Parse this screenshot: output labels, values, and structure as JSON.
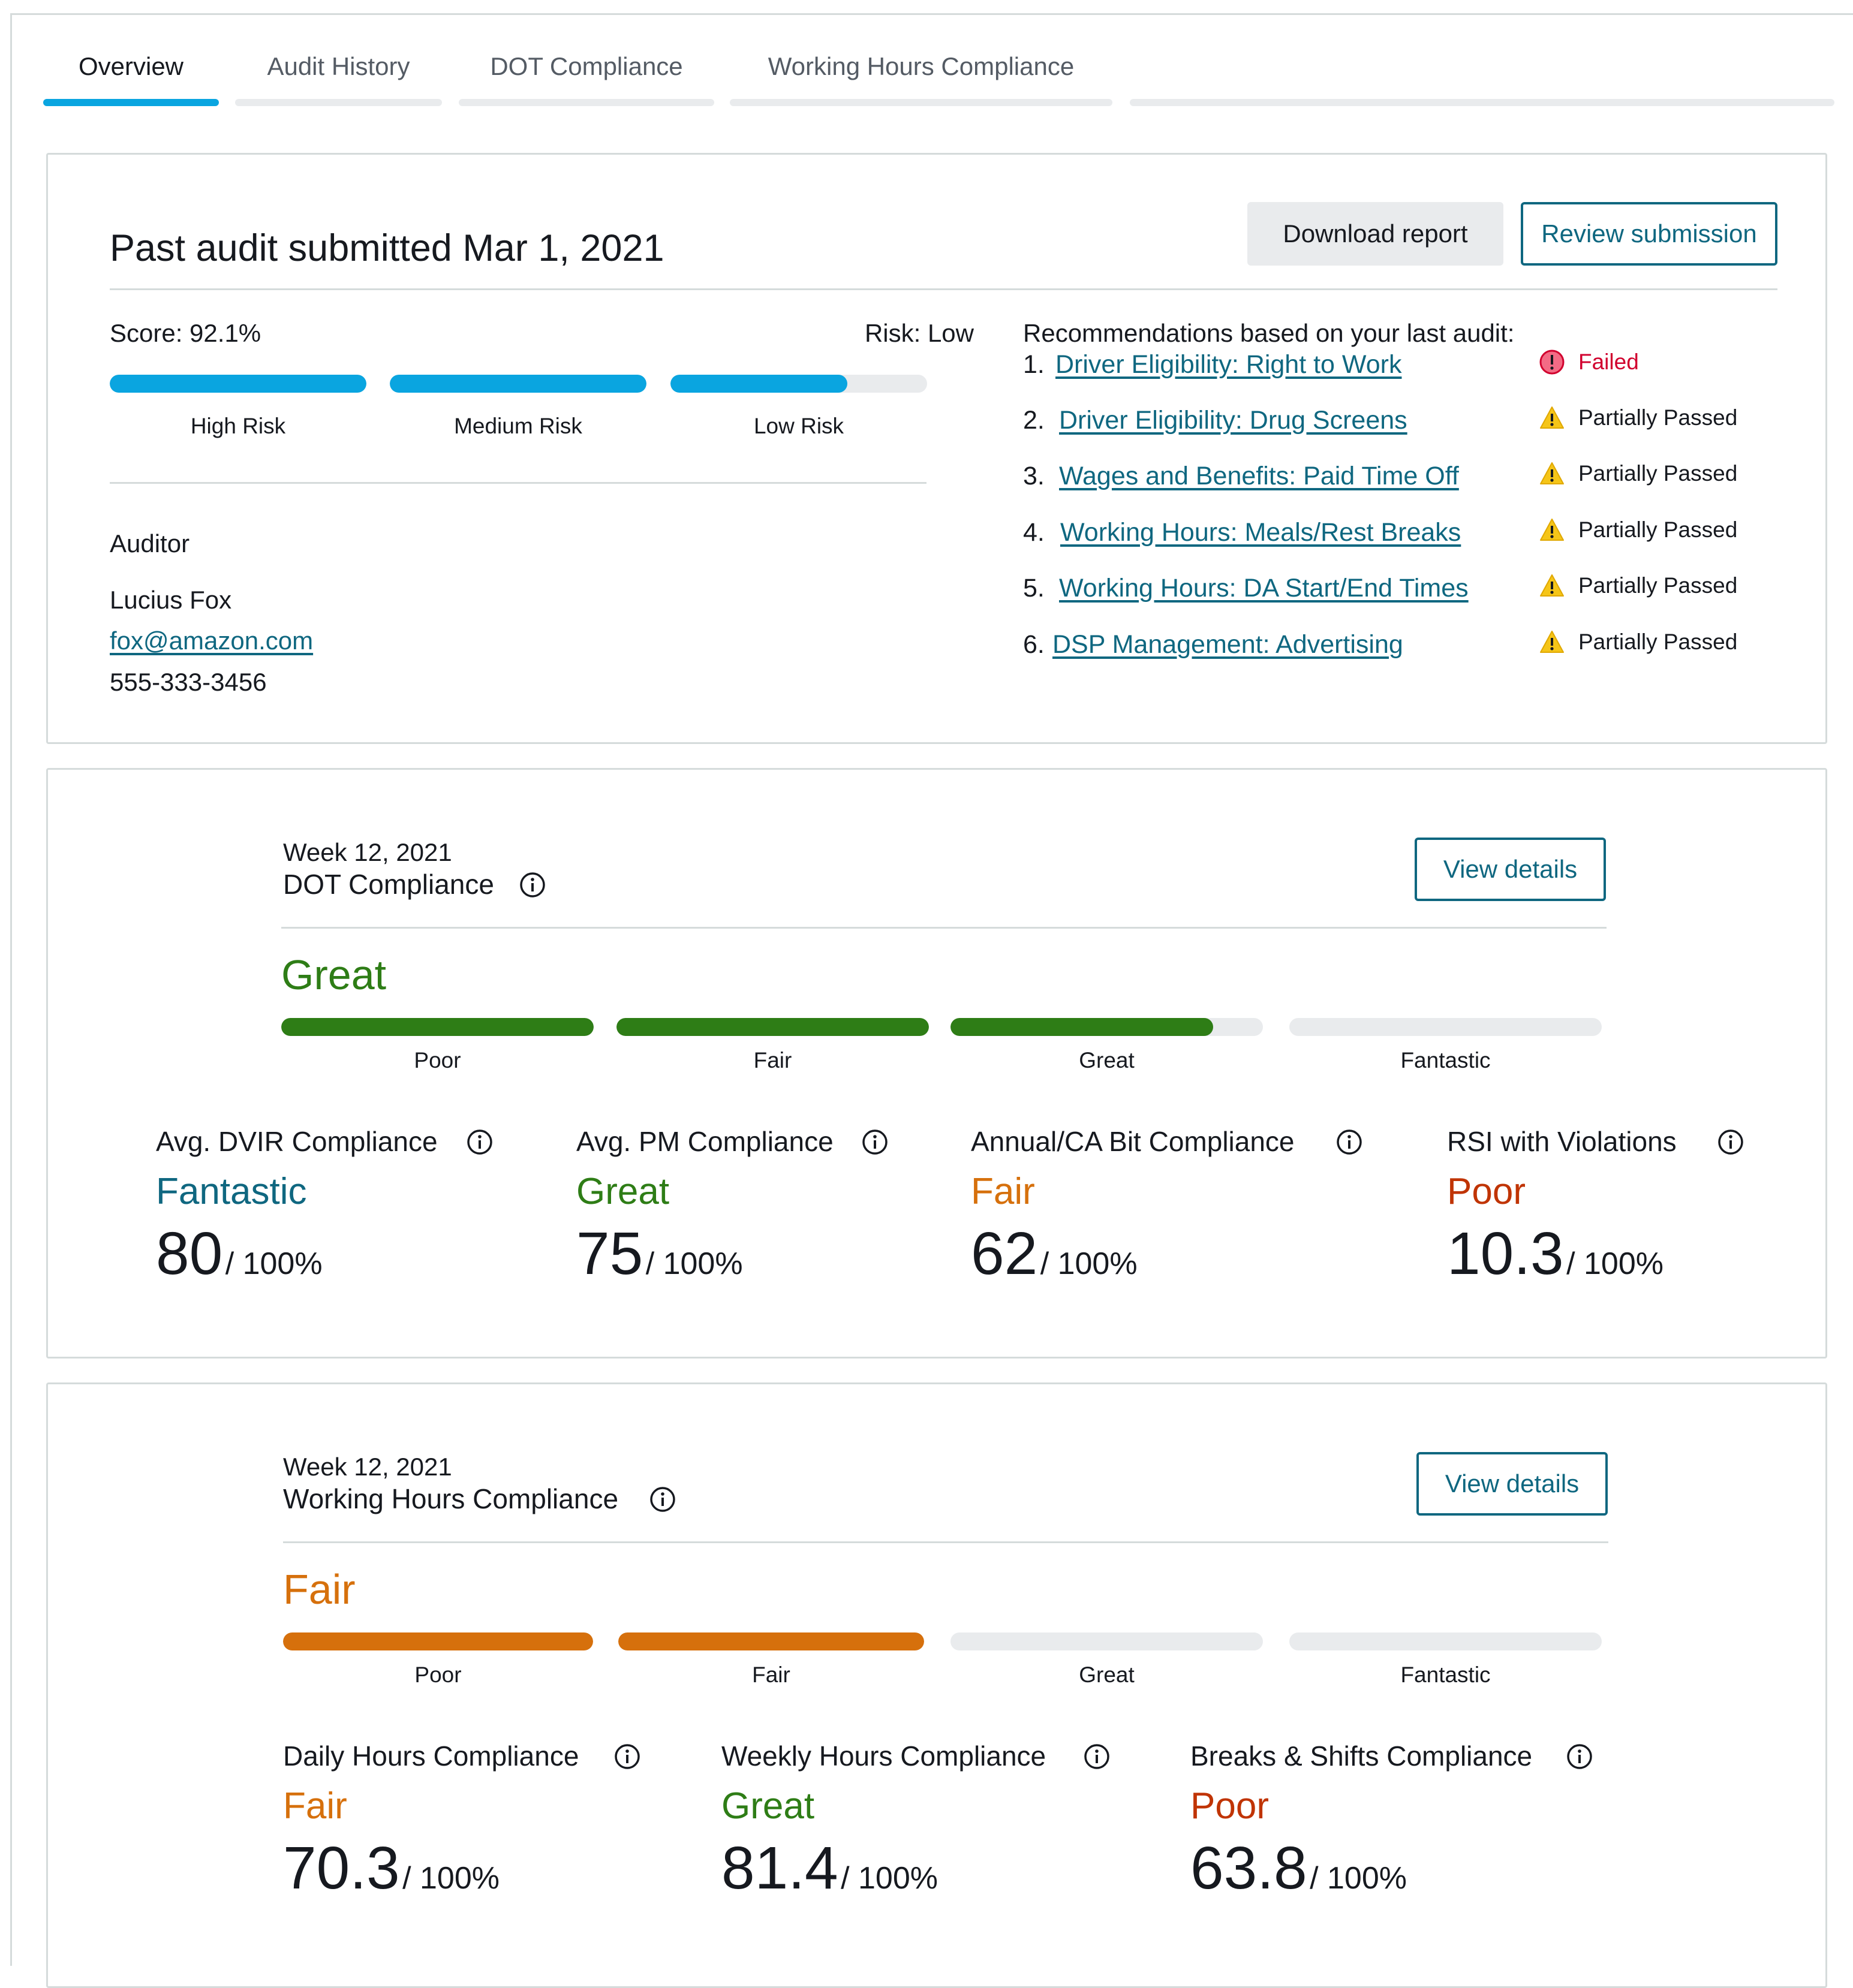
{
  "tabs": [
    {
      "label": "Overview",
      "active": true
    },
    {
      "label": "Audit History",
      "active": false
    },
    {
      "label": "DOT Compliance",
      "active": false
    },
    {
      "label": "Working Hours Compliance",
      "active": false
    }
  ],
  "audit": {
    "title": "Past audit submitted Mar 1, 2021",
    "download_label": "Download report",
    "review_label": "Review submission",
    "score_text": "Score: 92.1%",
    "risk_text": "Risk: Low",
    "risk_bars": [
      {
        "label": "High Risk",
        "fill": 1.0
      },
      {
        "label": "Medium Risk",
        "fill": 1.0
      },
      {
        "label": "Low Risk",
        "fill": 0.69
      }
    ],
    "auditor_heading": "Auditor",
    "auditor_name": "Lucius Fox",
    "auditor_email": "fox@amazon.com",
    "auditor_phone": "555-333-3456",
    "recommendations_heading": "Recommendations based on your last audit:",
    "recommendations": [
      {
        "num": "1.",
        "text": "Driver Eligibility: Right to Work",
        "status": "Failed",
        "status_type": "failed"
      },
      {
        "num": "2.",
        "text": "Driver Eligibility: Drug Screens",
        "status": "Partially Passed",
        "status_type": "warning"
      },
      {
        "num": "3.",
        "text": "Wages and Benefits: Paid Time Off",
        "status": "Partially Passed",
        "status_type": "warning"
      },
      {
        "num": "4.",
        "text": "Working Hours: Meals/Rest Breaks",
        "status": "Partially Passed",
        "status_type": "warning"
      },
      {
        "num": "5.",
        "text": "Working Hours: DA Start/End Times",
        "status": "Partially Passed",
        "status_type": "warning"
      },
      {
        "num": "6.",
        "text": "DSP Management: Advertising",
        "status": "Partially Passed",
        "status_type": "warning"
      }
    ]
  },
  "dot": {
    "week": "Week 12, 2021",
    "title": "DOT Compliance",
    "button_label": "View details",
    "rating": "Great",
    "tiers": [
      {
        "label": "Poor",
        "fill": 1.0
      },
      {
        "label": "Fair",
        "fill": 1.0
      },
      {
        "label": "Great",
        "fill": 0.84
      },
      {
        "label": "Fantastic",
        "fill": 0.0
      }
    ],
    "metrics": [
      {
        "title": "Avg. DVIR Compliance",
        "rating": "Fantastic",
        "value": "80",
        "suffix": "/ 100%"
      },
      {
        "title": "Avg. PM Compliance",
        "rating": "Great",
        "value": "75",
        "suffix": "/ 100%"
      },
      {
        "title": "Annual/CA Bit Compliance",
        "rating": "Fair",
        "value": "62",
        "suffix": "/ 100%"
      },
      {
        "title": "RSI with Violations",
        "rating": "Poor",
        "value": "10.3",
        "suffix": "/ 100%"
      }
    ]
  },
  "hours": {
    "week": "Week 12, 2021",
    "title": "Working Hours Compliance",
    "button_label": "View details",
    "rating": "Fair",
    "tiers": [
      {
        "label": "Poor",
        "fill": 1.0
      },
      {
        "label": "Fair",
        "fill": 1.0
      },
      {
        "label": "Great",
        "fill": 0.0
      },
      {
        "label": "Fantastic",
        "fill": 0.0
      }
    ],
    "metrics": [
      {
        "title": "Daily Hours Compliance",
        "rating": "Fair",
        "value": "70.3",
        "suffix": "/ 100%"
      },
      {
        "title": "Weekly Hours Compliance",
        "rating": "Great",
        "value": "81.4",
        "suffix": "/ 100%"
      },
      {
        "title": "Breaks & Shifts Compliance",
        "rating": "Poor",
        "value": "63.8",
        "suffix": "/ 100%"
      }
    ]
  },
  "colors": {
    "risk_fill": "#0aa5e0",
    "dot_fill": "#2e7d16",
    "hours_fill": "#d6700c",
    "Fantastic": "#0f6780",
    "Great": "#2e7d16",
    "Fair": "#d6700c",
    "Poor": "#c03404",
    "failed": "#d1002e",
    "warning": "#f5c518"
  }
}
